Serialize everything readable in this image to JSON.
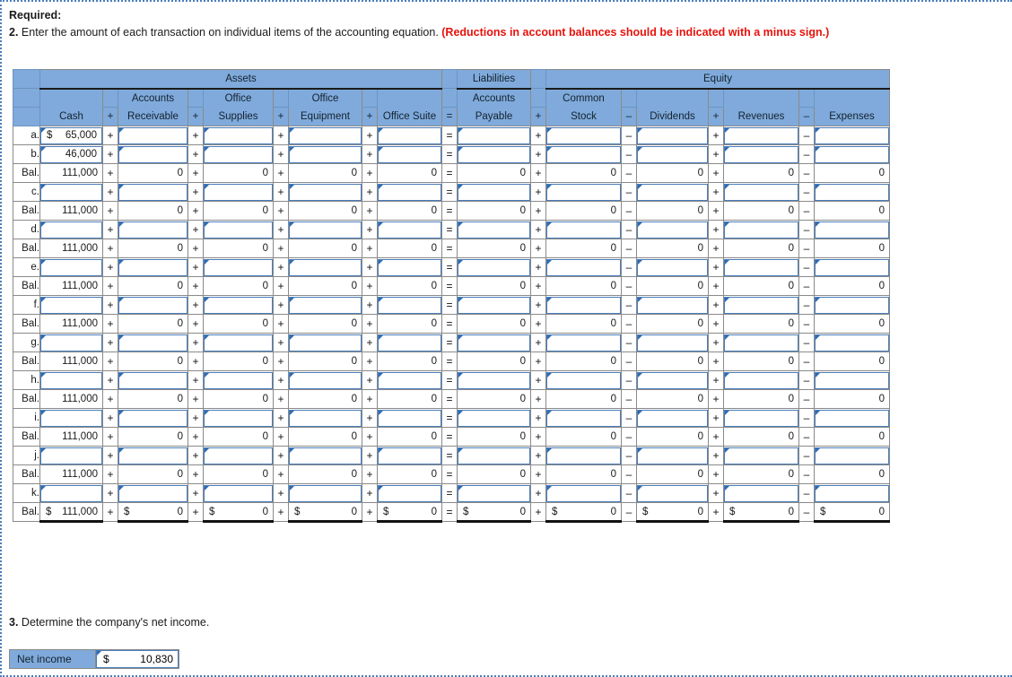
{
  "instructions": {
    "required_label": "Required:",
    "q2_num": "2.",
    "q2_text": " Enter the amount of each transaction on individual items of the accounting equation. ",
    "q2_note": "(Reductions in account balances should be indicated with a minus sign.)"
  },
  "worksheet": {
    "groups": {
      "assets": "Assets",
      "liabilities": "Liabilities",
      "equity": "Equity"
    },
    "columns": [
      {
        "top": "",
        "bottom": "Cash",
        "op_before": ""
      },
      {
        "top": "Accounts",
        "bottom": "Receivable",
        "op_before": "+"
      },
      {
        "top": "Office",
        "bottom": "Supplies",
        "op_before": "+"
      },
      {
        "top": "Office",
        "bottom": "Equipment",
        "op_before": "+"
      },
      {
        "top": "",
        "bottom": "Office Suite",
        "op_before": "+"
      },
      {
        "top": "Accounts",
        "bottom": "Payable",
        "op_before": "="
      },
      {
        "top": "Common",
        "bottom": "Stock",
        "op_before": "+"
      },
      {
        "top": "",
        "bottom": "Dividends",
        "op_before": "–"
      },
      {
        "top": "",
        "bottom": "Revenues",
        "op_before": "+"
      },
      {
        "top": "",
        "bottom": "Expenses",
        "op_before": "–"
      }
    ],
    "rows": [
      {
        "label": "a.",
        "type": "entry",
        "values": [
          "65,000",
          "",
          "",
          "",
          "",
          "",
          "",
          "",
          "",
          ""
        ],
        "dollar": [
          true,
          false,
          false,
          false,
          false,
          false,
          false,
          false,
          false,
          false
        ]
      },
      {
        "label": "b.",
        "type": "entry",
        "values": [
          "46,000",
          "",
          "",
          "",
          "",
          "",
          "",
          "",
          "",
          ""
        ],
        "dollar": [
          false,
          false,
          false,
          false,
          false,
          false,
          false,
          false,
          false,
          false
        ]
      },
      {
        "label": "Bal.",
        "type": "balance",
        "values": [
          "111,000",
          "0",
          "0",
          "0",
          "0",
          "0",
          "0",
          "0",
          "0",
          "0"
        ],
        "dollar": [
          false,
          false,
          false,
          false,
          false,
          false,
          false,
          false,
          false,
          false
        ]
      },
      {
        "label": "c.",
        "type": "entry",
        "values": [
          "",
          "",
          "",
          "",
          "",
          "",
          "",
          "",
          "",
          ""
        ],
        "dollar": [
          false,
          false,
          false,
          false,
          false,
          false,
          false,
          false,
          false,
          false
        ]
      },
      {
        "label": "Bal.",
        "type": "balance",
        "values": [
          "111,000",
          "0",
          "0",
          "0",
          "0",
          "0",
          "0",
          "0",
          "0",
          "0"
        ],
        "dollar": [
          false,
          false,
          false,
          false,
          false,
          false,
          false,
          false,
          false,
          false
        ]
      },
      {
        "label": "d.",
        "type": "entry",
        "values": [
          "",
          "",
          "",
          "",
          "",
          "",
          "",
          "",
          "",
          ""
        ],
        "dollar": [
          false,
          false,
          false,
          false,
          false,
          false,
          false,
          false,
          false,
          false
        ]
      },
      {
        "label": "Bal.",
        "type": "balance",
        "values": [
          "111,000",
          "0",
          "0",
          "0",
          "0",
          "0",
          "0",
          "0",
          "0",
          "0"
        ],
        "dollar": [
          false,
          false,
          false,
          false,
          false,
          false,
          false,
          false,
          false,
          false
        ]
      },
      {
        "label": "e.",
        "type": "entry",
        "values": [
          "",
          "",
          "",
          "",
          "",
          "",
          "",
          "",
          "",
          ""
        ],
        "dollar": [
          false,
          false,
          false,
          false,
          false,
          false,
          false,
          false,
          false,
          false
        ]
      },
      {
        "label": "Bal.",
        "type": "balance",
        "values": [
          "111,000",
          "0",
          "0",
          "0",
          "0",
          "0",
          "0",
          "0",
          "0",
          "0"
        ],
        "dollar": [
          false,
          false,
          false,
          false,
          false,
          false,
          false,
          false,
          false,
          false
        ]
      },
      {
        "label": "f.",
        "type": "entry",
        "values": [
          "",
          "",
          "",
          "",
          "",
          "",
          "",
          "",
          "",
          ""
        ],
        "dollar": [
          false,
          false,
          false,
          false,
          false,
          false,
          false,
          false,
          false,
          false
        ]
      },
      {
        "label": "Bal.",
        "type": "balance",
        "values": [
          "111,000",
          "0",
          "0",
          "0",
          "0",
          "0",
          "0",
          "0",
          "0",
          "0"
        ],
        "dollar": [
          false,
          false,
          false,
          false,
          false,
          false,
          false,
          false,
          false,
          false
        ]
      },
      {
        "label": "g.",
        "type": "entry",
        "values": [
          "",
          "",
          "",
          "",
          "",
          "",
          "",
          "",
          "",
          ""
        ],
        "dollar": [
          false,
          false,
          false,
          false,
          false,
          false,
          false,
          false,
          false,
          false
        ]
      },
      {
        "label": "Bal.",
        "type": "balance",
        "values": [
          "111,000",
          "0",
          "0",
          "0",
          "0",
          "0",
          "0",
          "0",
          "0",
          "0"
        ],
        "dollar": [
          false,
          false,
          false,
          false,
          false,
          false,
          false,
          false,
          false,
          false
        ]
      },
      {
        "label": "h.",
        "type": "entry",
        "values": [
          "",
          "",
          "",
          "",
          "",
          "",
          "",
          "",
          "",
          ""
        ],
        "dollar": [
          false,
          false,
          false,
          false,
          false,
          false,
          false,
          false,
          false,
          false
        ]
      },
      {
        "label": "Bal.",
        "type": "balance",
        "values": [
          "111,000",
          "0",
          "0",
          "0",
          "0",
          "0",
          "0",
          "0",
          "0",
          "0"
        ],
        "dollar": [
          false,
          false,
          false,
          false,
          false,
          false,
          false,
          false,
          false,
          false
        ]
      },
      {
        "label": "i.",
        "type": "entry",
        "values": [
          "",
          "",
          "",
          "",
          "",
          "",
          "",
          "",
          "",
          ""
        ],
        "dollar": [
          false,
          false,
          false,
          false,
          false,
          false,
          false,
          false,
          false,
          false
        ]
      },
      {
        "label": "Bal.",
        "type": "balance",
        "values": [
          "111,000",
          "0",
          "0",
          "0",
          "0",
          "0",
          "0",
          "0",
          "0",
          "0"
        ],
        "dollar": [
          false,
          false,
          false,
          false,
          false,
          false,
          false,
          false,
          false,
          false
        ]
      },
      {
        "label": "j.",
        "type": "entry",
        "values": [
          "",
          "",
          "",
          "",
          "",
          "",
          "",
          "",
          "",
          ""
        ],
        "dollar": [
          false,
          false,
          false,
          false,
          false,
          false,
          false,
          false,
          false,
          false
        ]
      },
      {
        "label": "Bal.",
        "type": "balance",
        "values": [
          "111,000",
          "0",
          "0",
          "0",
          "0",
          "0",
          "0",
          "0",
          "0",
          "0"
        ],
        "dollar": [
          false,
          false,
          false,
          false,
          false,
          false,
          false,
          false,
          false,
          false
        ]
      },
      {
        "label": "k.",
        "type": "entry",
        "values": [
          "",
          "",
          "",
          "",
          "",
          "",
          "",
          "",
          "",
          ""
        ],
        "dollar": [
          false,
          false,
          false,
          false,
          false,
          false,
          false,
          false,
          false,
          false
        ]
      },
      {
        "label": "Bal.",
        "type": "total",
        "values": [
          "111,000",
          "0",
          "0",
          "0",
          "0",
          "0",
          "0",
          "0",
          "0",
          "0"
        ],
        "dollar": [
          true,
          true,
          true,
          true,
          true,
          true,
          true,
          true,
          true,
          true
        ]
      }
    ],
    "dollar_symbol": "$"
  },
  "part3": {
    "q3_num": "3.",
    "q3_text": " Determine the company's net income.",
    "net_income_label": "Net income",
    "net_income_dollar": "$",
    "net_income_value": "10,830"
  },
  "colors": {
    "header_blue": "#7FAADB",
    "input_border": "#4a7ebb",
    "note_red": "#e8120b"
  }
}
